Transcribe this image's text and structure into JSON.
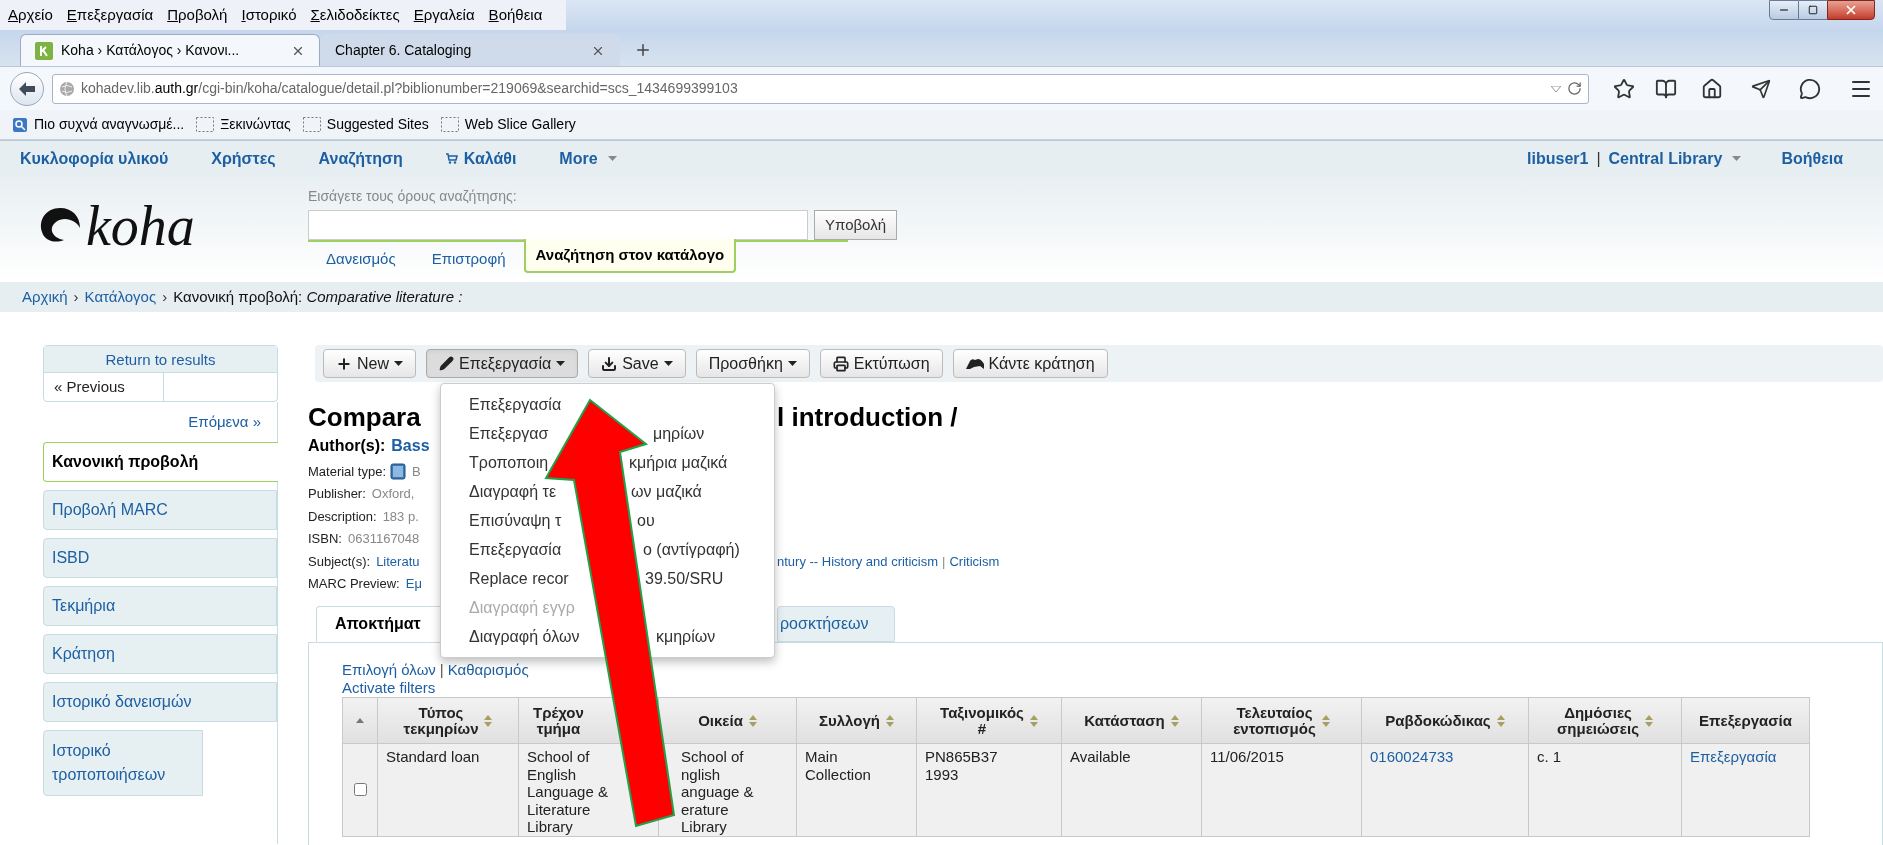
{
  "browser": {
    "menu": [
      "Αρχείο",
      "Επεξεργασία",
      "Προβολή",
      "Ιστορικό",
      "Σελιδοδείκτες",
      "Εργαλεία",
      "Βοήθεια"
    ],
    "tabs": [
      {
        "label": "Koha › Κατάλογος › Κανονι...",
        "selected": true
      },
      {
        "label": "Chapter 6. Cataloging",
        "selected": false
      }
    ],
    "url": "kohadev.lib.**auth.gr**/cgi-bin/koha/catalogue/detail.pl?biblionumber=219069&searchid=scs_1434699399103",
    "bookmarks": [
      {
        "label": "Πιο συχνά αναγνωσμέ...",
        "kind": "recent"
      },
      {
        "label": "Ξεκινώντας",
        "kind": "folder"
      },
      {
        "label": "Suggested Sites",
        "kind": "folder"
      },
      {
        "label": "Web Slice Gallery",
        "kind": "folder"
      }
    ]
  },
  "koha": {
    "nav": [
      {
        "label": "Κυκλοφορία υλικού",
        "kind": "link"
      },
      {
        "label": "Χρήστες",
        "kind": "link"
      },
      {
        "label": "Αναζήτηση",
        "kind": "link"
      },
      {
        "label": "Καλάθι",
        "kind": "cart"
      },
      {
        "label": "More",
        "kind": "dropdown"
      }
    ],
    "user": "libuser1",
    "separator": "|",
    "library": "Central Library",
    "help": "Βοήθεια",
    "logo": "koha",
    "search": {
      "label": "Εισάγετε τους όρους αναζήτησης:",
      "submit": "Υποβολή",
      "tabs": [
        {
          "label": "Δανεισμός",
          "selected": false
        },
        {
          "label": "Επιστροφή",
          "selected": false
        },
        {
          "label": "Αναζήτηση στον κατάλογο",
          "selected": true
        }
      ]
    },
    "breadcrumb": {
      "separator": "›",
      "items": [
        {
          "text": "Αρχική",
          "kind": "link"
        },
        {
          "text": "Κατάλογος",
          "kind": "link"
        },
        {
          "text": "Κανονική προβολή: *Comparative literature :*",
          "kind": "current"
        }
      ]
    }
  },
  "sidebar": {
    "return": "Return to results",
    "previous": "« Previous",
    "next": "Επόμενα »",
    "views": [
      {
        "label": "Κανονική προβολή",
        "selected": true
      },
      {
        "label": "Προβολή MARC",
        "selected": false
      },
      {
        "label": "ISBD",
        "selected": false
      },
      {
        "label": "Τεκμήρια",
        "selected": false
      },
      {
        "label": "Κράτηση",
        "selected": false
      },
      {
        "label": "Ιστορικό δανεισμών",
        "selected": false
      },
      {
        "label": "Ιστορικό τροποποιήσεων",
        "selected": false
      }
    ]
  },
  "toolbar": [
    {
      "label": "New",
      "caret": true,
      "open": false
    },
    {
      "label": "Επεξεργασία",
      "caret": true,
      "open": true
    },
    {
      "label": "Save",
      "caret": true,
      "open": false
    },
    {
      "label": "Προσθήκη",
      "caret": true,
      "open": false
    },
    {
      "label": "Εκτύπωση",
      "caret": false,
      "open": false
    },
    {
      "label": "Κάντε κράτηση",
      "caret": false,
      "open": false
    }
  ],
  "edit_menu": [
    {
      "segments": [
        "Επεξεργασία"
      ],
      "disabled": false
    },
    {
      "segments": [
        "Επεξεργασ",
        "μηρίων"
      ],
      "disabled": false
    },
    {
      "segments": [
        "Τροποποιη",
        "κμήρια μαζικά"
      ],
      "disabled": false
    },
    {
      "segments": [
        "Διαγραφή τε",
        "ων μαζικά"
      ],
      "disabled": false
    },
    {
      "segments": [
        "Επισύναψη τ",
        "ου"
      ],
      "disabled": false
    },
    {
      "segments": [
        "Επεξεργασία",
        "ο (αντίγραφή)"
      ],
      "disabled": false
    },
    {
      "segments": [
        "Replace recor",
        "39.50/SRU"
      ],
      "disabled": false
    },
    {
      "segments": [
        "Διαγραφή εγγρ"
      ],
      "disabled": true
    },
    {
      "segments": [
        "Διαγραφή όλων",
        "κμηρίων"
      ],
      "disabled": false
    }
  ],
  "record": {
    "title": [
      "Compara",
      "l introduction /"
    ],
    "author": {
      "label": "Author(s):",
      "name": "Bass"
    },
    "fields": [
      {
        "label": "Material type:",
        "kind": "material",
        "value": "B"
      },
      {
        "label": "Publisher:",
        "kind": "text",
        "value": "Oxford,"
      },
      {
        "label": "Description:",
        "kind": "text",
        "value": "183 p."
      },
      {
        "label": "ISBN:",
        "kind": "text",
        "value": "0631167048"
      },
      {
        "label": "Subject(s):",
        "kind": "links",
        "value": "Literatu",
        "rest": [
          "ntury -- History and criticism",
          "Criticism"
        ],
        "separator": "|"
      },
      {
        "label": "MARC Preview:",
        "kind": "links",
        "value": "Εμ"
      }
    ]
  },
  "holdings_tabs": [
    {
      "label": "Αποκτήματ",
      "selected": true
    },
    {
      "label": "ροσκτήσεων",
      "selected": false
    }
  ],
  "holdings": {
    "select_all": "Επιλογή όλων",
    "separator": "|",
    "clear": "Καθαρισμός",
    "filters": "Activate filters",
    "columns": [
      "Τύπος τεκμηρίων",
      "Τρέχον τμήμα",
      "Οικεία",
      "Συλλογή",
      "Ταξινομικός #",
      "Κατάσταση",
      "Τελευταίος εντοπισμός",
      "Ραβδοκώδικας",
      "Δημόσιες σημειώσεις",
      "Επεξεργασία"
    ],
    "rows": [
      {
        "selected": false,
        "cells": [
          {
            "kind": "text",
            "lines": [
              "Standard loan"
            ]
          },
          {
            "kind": "text",
            "lines": [
              "School of",
              "English",
              "Language &",
              "Literature",
              "Library"
            ]
          },
          {
            "kind": "text",
            "lines": [
              "School of",
              "nglish",
              "anguage &",
              "erature",
              "Library"
            ]
          },
          {
            "kind": "text",
            "lines": [
              "Main",
              "Collection"
            ]
          },
          {
            "kind": "text",
            "lines": [
              "PN865B37",
              "1993"
            ]
          },
          {
            "kind": "text",
            "lines": [
              "Available"
            ]
          },
          {
            "kind": "text",
            "lines": [
              "11/06/2015"
            ]
          },
          {
            "kind": "link",
            "lines": [
              "0160024733"
            ]
          },
          {
            "kind": "text",
            "lines": [
              "c. 1"
            ]
          },
          {
            "kind": "link",
            "lines": [
              "Επεξεργασία"
            ]
          }
        ]
      }
    ]
  }
}
